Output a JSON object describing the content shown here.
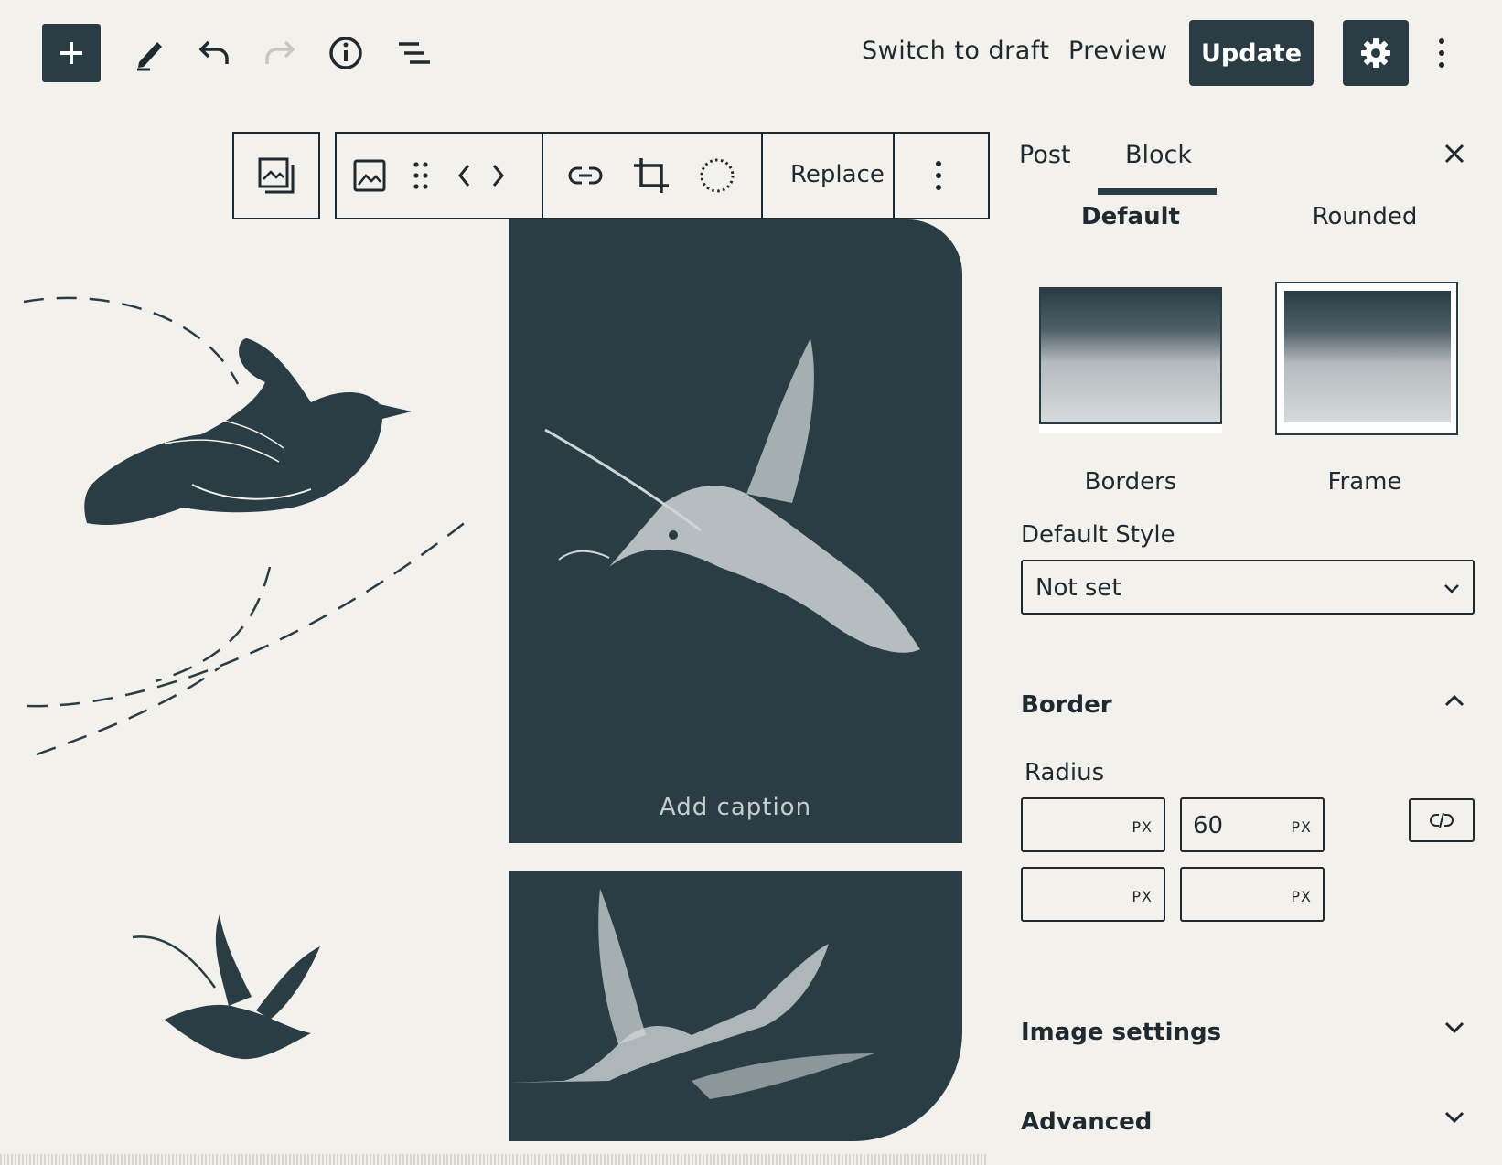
{
  "toolbar": {
    "switch_to_draft": "Switch to draft",
    "preview": "Preview",
    "update": "Update"
  },
  "block_toolbar": {
    "replace": "Replace"
  },
  "canvas": {
    "caption_placeholder": "Add caption"
  },
  "sidebar": {
    "tabs": [
      "Post",
      "Block"
    ],
    "active_tab": "Block",
    "styles": {
      "default": "Default",
      "rounded": "Rounded",
      "borders": "Borders",
      "frame": "Frame"
    },
    "default_style_label": "Default Style",
    "default_style_value": "Not set",
    "border": {
      "title": "Border",
      "radius_label": "Radius",
      "radius_values": [
        "",
        "60",
        "",
        ""
      ],
      "unit": "PX"
    },
    "image_settings": "Image settings",
    "advanced": "Advanced"
  },
  "colors": {
    "background": "#f3f1ec",
    "dark": "#2a3d45"
  }
}
